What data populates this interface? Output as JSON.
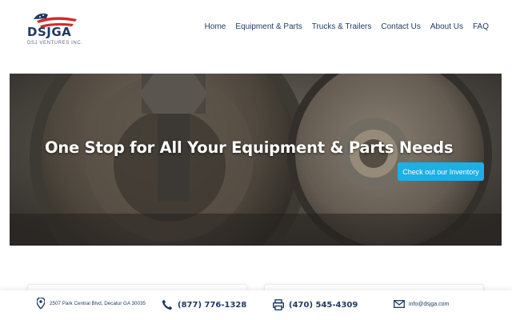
{
  "brand": {
    "name": "DSJGA",
    "tagline": "DSJ VENTURES INC."
  },
  "nav": {
    "items": [
      {
        "label": "Home"
      },
      {
        "label": "Equipment & Parts"
      },
      {
        "label": "Trucks & Trailers"
      },
      {
        "label": "Contact Us"
      },
      {
        "label": "About Us"
      },
      {
        "label": "FAQ"
      }
    ]
  },
  "hero": {
    "title": "One Stop for All Your Equipment & Parts Needs",
    "cta_label": "Check out our Inventory"
  },
  "contact": {
    "address": "2507 Park Central Blvd, Decatur GA 30035",
    "phone": "(877) 776-1328",
    "fax": "(470) 545-4309",
    "email": "info@dsjga.com"
  },
  "colors": {
    "brand_navy": "#1e3a5f",
    "accent_blue": "#1bb0e6",
    "flag_red": "#d32b2b"
  }
}
